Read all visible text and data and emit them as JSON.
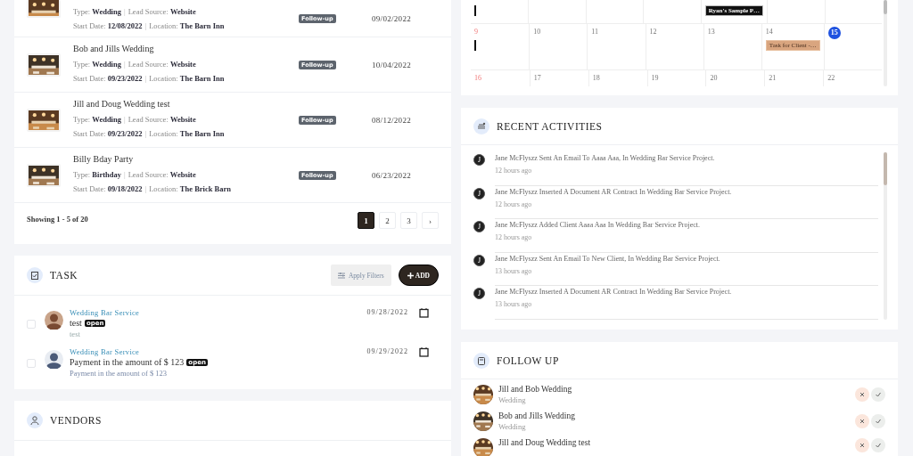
{
  "events": {
    "rows": [
      {
        "separators": [
          "|",
          "|"
        ],
        "type_label": "Type:",
        "type": "Wedding",
        "lead_label": "Lead Source:",
        "lead": "Website",
        "start_label": "Start Date:",
        "start": "12/08/2022",
        "location_label": "Location:",
        "location": "The Barn Inn",
        "status": "Follow-up",
        "date": "09/02/2022"
      },
      {
        "title": "Bob and Jills Wedding",
        "separators": [
          "|",
          "|"
        ],
        "type_label": "Type:",
        "type": "Wedding",
        "lead_label": "Lead Source:",
        "lead": "Website",
        "start_label": "Start Date:",
        "start": "09/23/2022",
        "location_label": "Location:",
        "location": "The Barn Inn",
        "status": "Follow-up",
        "date": "10/04/2022"
      },
      {
        "title": "Jill and Doug Wedding test",
        "separators": [
          "|",
          "|"
        ],
        "type_label": "Type:",
        "type": "Wedding",
        "lead_label": "Lead Source:",
        "lead": "Website",
        "start_label": "Start Date:",
        "start": "09/23/2022",
        "location_label": "Location:",
        "location": "The Barn Inn",
        "status": "Follow-up",
        "date": "08/12/2022"
      },
      {
        "title": "Billy Bday Party",
        "separators": [
          "|",
          "|"
        ],
        "type_label": "Type:",
        "type": "Birthday",
        "lead_label": "Lead Source:",
        "lead": "Website",
        "start_label": "Start Date:",
        "start": "09/18/2022",
        "location_label": "Location:",
        "location": "The Brick Barn",
        "status": "Follow-up",
        "date": "06/23/2022"
      }
    ],
    "summary": "Showing 1 - 5 of 20",
    "pages": [
      {
        "label": "1",
        "selected": true
      },
      {
        "label": "2",
        "selected": false
      },
      {
        "label": "3",
        "selected": false
      },
      {
        "label": "›",
        "selected": false
      }
    ]
  },
  "task": {
    "title": "TASK",
    "filter_button": "Apply Filters",
    "add_button": "ADD",
    "items": [
      {
        "project": "Wedding Bar Service",
        "title": "test",
        "status": "open",
        "note": "test",
        "date": "09/28/2022",
        "checked": false
      },
      {
        "project": "Wedding Bar Service",
        "title": "Payment in the amount of $ 123",
        "status": "open",
        "note": "Payment in the amount of $ 123",
        "date": "09/29/2022",
        "checked": false,
        "kind": "default"
      }
    ]
  },
  "vendors": {
    "title": "VENDORS"
  },
  "calendar": {
    "weeks": [
      {
        "days": [
          {
            "kind": "cut",
            "events": [
              {
                "kind": "marker"
              }
            ]
          },
          {
            "kind": "cut"
          },
          {
            "kind": "cut"
          },
          {
            "kind": "cut"
          },
          {
            "kind": "cut",
            "events": [
              {
                "kind": "dark",
                "title": "Ryan's Sample P…"
              }
            ]
          },
          {
            "kind": "cut"
          },
          {
            "kind": "cut"
          }
        ]
      },
      {
        "days": [
          {
            "day": "9",
            "today": false,
            "events": [
              {
                "kind": "marker"
              }
            ]
          },
          {
            "day": "10",
            "today": false
          },
          {
            "day": "11",
            "today": false
          },
          {
            "day": "12",
            "today": false
          },
          {
            "day": "13",
            "today": false
          },
          {
            "day": "14",
            "today": false,
            "events": [
              {
                "kind": "task",
                "title": "Task for Client -…"
              }
            ]
          },
          {
            "day": "15",
            "today": true
          }
        ]
      },
      {
        "days": [
          {
            "day": "16",
            "today": false
          },
          {
            "day": "17",
            "today": false
          },
          {
            "day": "18",
            "today": false
          },
          {
            "day": "19",
            "today": false
          },
          {
            "day": "20",
            "today": false
          },
          {
            "day": "21",
            "today": false
          },
          {
            "day": "22",
            "today": false
          }
        ]
      }
    ]
  },
  "activities": {
    "title": "RECENT ACTIVITIES",
    "items": [
      {
        "initial": "J",
        "text": "Jane McFlyszz Sent An Email To Aaaa Aaa, In Wedding Bar Service Project.",
        "time": "12 hours ago"
      },
      {
        "initial": "J",
        "text": "Jane McFlyszz Inserted A Document AR Contract In Wedding Bar Service Project.",
        "time": "12 hours ago"
      },
      {
        "initial": "J",
        "text": "Jane McFlyszz Added Client Aaaa Aaa In Wedding Bar Service Project.",
        "time": "12 hours ago"
      },
      {
        "initial": "J",
        "text": "Jane McFlyszz Sent An Email To New Client, In Wedding Bar Service Project.",
        "time": "13 hours ago"
      },
      {
        "initial": "J",
        "text": "Jane McFlyszz Inserted A Document AR Contract In Wedding Bar Service Project.",
        "time": "13 hours ago"
      }
    ]
  },
  "follow_up": {
    "title": "FOLLOW UP",
    "items": [
      {
        "title": "Jill and Bob Wedding",
        "subtitle": "Wedding"
      },
      {
        "title": "Bob and Jills Wedding",
        "subtitle": "Wedding"
      },
      {
        "title": "Jill and Doug Wedding test"
      }
    ]
  }
}
